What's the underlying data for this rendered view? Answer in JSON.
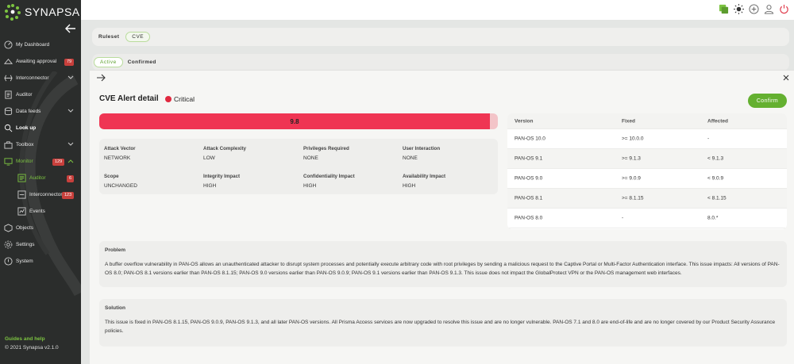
{
  "app": {
    "logo_text": "SYNAPSA"
  },
  "sidebar": {
    "items": [
      {
        "label": "My Dashboard",
        "icon": "dashboard-icon"
      },
      {
        "label": "Awaiting approval",
        "icon": "approval-icon",
        "badge": "79"
      },
      {
        "label": "Interconnector",
        "icon": "interconnector-icon"
      },
      {
        "label": "Auditor",
        "icon": "auditor-icon"
      },
      {
        "label": "Data feeds",
        "icon": "data-feeds-icon"
      },
      {
        "label": "Look up",
        "icon": "lookup-icon"
      },
      {
        "label": "Toolbox",
        "icon": "toolbox-icon"
      },
      {
        "label": "Monitor",
        "icon": "monitor-icon",
        "badge": "129"
      },
      {
        "label": "Auditor",
        "icon": "auditor-icon",
        "badge": "6"
      },
      {
        "label": "Interconnector",
        "icon": "interconnector-icon",
        "badge": "123"
      },
      {
        "label": "Events",
        "icon": "events-icon"
      },
      {
        "label": "Objects",
        "icon": "objects-icon"
      },
      {
        "label": "Settings",
        "icon": "settings-icon"
      },
      {
        "label": "System",
        "icon": "system-icon"
      }
    ],
    "footer": {
      "guides": "Guides and help",
      "copyright": "© 2021 Synapsa v2.1.0"
    }
  },
  "ruleset": {
    "label": "Ruleset",
    "value": "CVE"
  },
  "status_tabs": {
    "active": "Active",
    "confirmed": "Confirmed"
  },
  "detail": {
    "title": "CVE Alert detail",
    "severity": "Critical",
    "confirm_label": "Confirm",
    "score": "9.8",
    "score_fraction": 0.98,
    "metrics": [
      {
        "label": "Attack Vector",
        "value": "NETWORK"
      },
      {
        "label": "Attack Complexity",
        "value": "LOW"
      },
      {
        "label": "Privileges Required",
        "value": "NONE"
      },
      {
        "label": "User Interaction",
        "value": "NONE"
      },
      {
        "label": "Scope",
        "value": "UNCHANGED"
      },
      {
        "label": "Integrity Impact",
        "value": "HIGH"
      },
      {
        "label": "Confidentiality Impact",
        "value": "HIGH"
      },
      {
        "label": "Availability Impact",
        "value": "HIGH"
      }
    ],
    "versions": {
      "headers": [
        "Version",
        "Fixed",
        "Affected"
      ],
      "rows": [
        [
          "PAN-OS 10.0",
          ">= 10.0.0",
          "-"
        ],
        [
          "PAN-OS 9.1",
          ">= 9.1.3",
          "< 9.1.3"
        ],
        [
          "PAN-OS 9.0",
          ">= 9.0.9",
          "< 9.0.9"
        ],
        [
          "PAN-OS 8.1",
          ">= 8.1.15",
          "< 8.1.15"
        ],
        [
          "PAN-OS 8.0",
          "-",
          "8.0.*"
        ]
      ]
    },
    "problem": {
      "label": "Problem",
      "text": "A buffer overflow vulnerability in PAN-OS allows an unauthenticated attacker to disrupt system processes and potentially execute arbitrary code with root privileges by sending a malicious request to the Captive Portal or Multi-Factor Authentication interface. This issue impacts: All versions of PAN-OS 8.0; PAN-OS 8.1 versions earlier than PAN-OS 8.1.15; PAN-OS 9.0 versions earlier than PAN-OS 9.0.9; PAN-OS 9.1 versions earlier than PAN-OS 9.1.3. This issue does not impact the GlobalProtect VPN or the PAN-OS management web interfaces."
    },
    "solution": {
      "label": "Solution",
      "text": "This issue is fixed in PAN-OS 8.1.15, PAN-OS 9.0.9, PAN-OS 9.1.3, and all later PAN-OS versions. All Prisma Access services are now upgraded to resolve this issue and are no longer vulnerable. PAN-OS 7.1 and 8.0 are end-of-life and are no longer covered by our Product Security Assurance policies."
    }
  },
  "colors": {
    "accent": "#64b030",
    "critical": "#ef3553",
    "badge": "#c8403c"
  }
}
